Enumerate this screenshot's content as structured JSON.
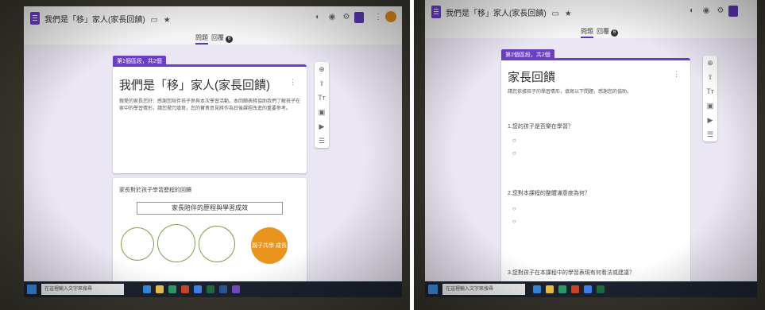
{
  "left_window": {
    "doc_title": "我們是「移」家人(家長回饋)",
    "tabs": {
      "questions_label": "問題",
      "responses_label": "回覆",
      "responses_badge": "6"
    },
    "section_tag": "第1個區段，共2個",
    "form_title": "我們是「移」家人(家長回饋)",
    "form_description": "親愛的家長您好：感謝您陪伴孩子參與本次學習活動。本回饋表將協助我們了解孩子在家中的學習情形，請您撥冗填寫，您的寶貴意見將作為日後課程改進的重要參考。",
    "diagram_caption": "家長對於孩子學習歷程的回饋",
    "diagram_title": "家長陪伴的歷程與學習成效",
    "diagram_bubble_text": "親子共學\n成長",
    "search_placeholder": "在這裡輸入文字來搜尋"
  },
  "right_window": {
    "doc_title": "我們是「移」家人(家長回饋)",
    "tabs": {
      "questions_label": "問題",
      "responses_label": "回覆",
      "responses_badge": "6"
    },
    "section_tag": "第2個區段，共2個",
    "form_title": "家長回饋",
    "form_description": "請您依據孩子的學習情形，填寫以下問題，感謝您的協助。",
    "questions": [
      "1.您的孩子是否樂在學習？",
      "2.您對本課程的整體滿意度為何？",
      "3.您對孩子在本課程中的學習表現有何看法或建議？"
    ],
    "search_placeholder": "在這裡輸入文字來搜尋"
  },
  "colors": {
    "accent": "#6a3fc2",
    "send": "#5b35b5",
    "avatar": "#e08a1e",
    "diagram_orange": "#e8941e"
  },
  "icons": [
    "palette-icon",
    "eye-icon",
    "settings-icon",
    "more-vert-icon",
    "add-circle-icon",
    "import-icon",
    "title-icon",
    "image-icon",
    "video-icon",
    "section-icon"
  ]
}
